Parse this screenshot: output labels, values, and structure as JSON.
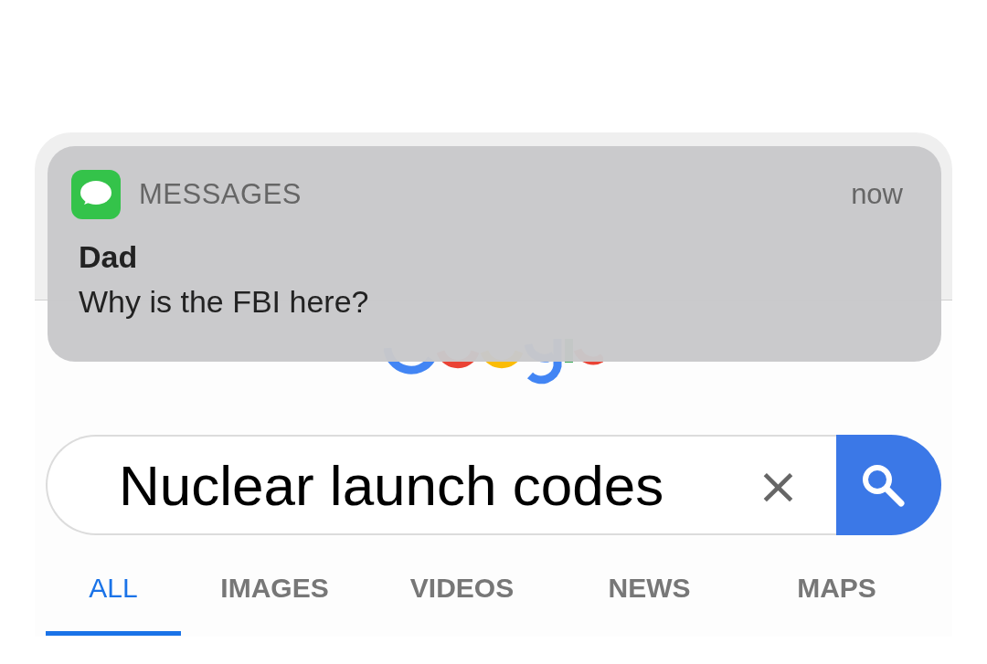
{
  "notification": {
    "app": "MESSAGES",
    "time": "now",
    "sender": "Dad",
    "message": "Why is the FBI here?"
  },
  "search": {
    "value": "Nuclear launch codes",
    "clear": "×"
  },
  "tabs": [
    {
      "label": "ALL",
      "selected": true
    },
    {
      "label": "IMAGES",
      "selected": false
    },
    {
      "label": "VIDEOS",
      "selected": false
    },
    {
      "label": "NEWS",
      "selected": false
    },
    {
      "label": "MAPS",
      "selected": false
    }
  ]
}
